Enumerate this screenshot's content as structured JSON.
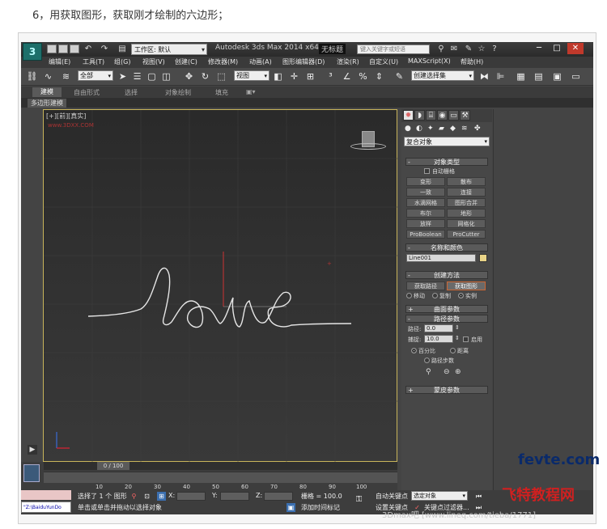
{
  "caption": "6，用获取图形，获取刚才绘制的六边形；",
  "titlebar": {
    "logo": "3",
    "workspace": "工作区: 默认",
    "app_title": "Autodesk 3ds Max  2014 x64",
    "file_name": "无标题",
    "search_placeholder": "键入关键字或短语",
    "help": "?"
  },
  "menu": [
    "编辑(E)",
    "工具(T)",
    "组(G)",
    "视图(V)",
    "创建(C)",
    "修改器(M)",
    "动画(A)",
    "图形编辑器(D)",
    "渲染(R)",
    "自定义(U)",
    "MAXScript(X)",
    "帮助(H)"
  ],
  "toolbar": {
    "selection_filter": "全部",
    "reference_coord": "视图",
    "named_selection": "创建选择集"
  },
  "ribbon": {
    "tabs": [
      "建模",
      "自由形式",
      "选择",
      "对象绘制",
      "填充"
    ],
    "active_tab": "建模",
    "sub_label": "多边形建模"
  },
  "viewport": {
    "label": "[+][前][真实]",
    "watermark": "www.3DXX.COM"
  },
  "command_panel": {
    "category": "复合对象",
    "object_type": {
      "title": "对象类型",
      "autogrid": "自动栅格",
      "buttons": [
        "变形",
        "散布",
        "一致",
        "连接",
        "水滴网格",
        "图形合并",
        "布尔",
        "地形",
        "放样",
        "网格化",
        "ProBoolean",
        "ProCutter"
      ]
    },
    "name_color": {
      "title": "名称和颜色",
      "name": "Line001",
      "color": "#e9d488"
    },
    "creation_method": {
      "title": "创建方法",
      "get_path": "获取路径",
      "get_shape": "获取图形",
      "options": [
        "移动",
        "复制",
        "实例"
      ],
      "selected": "实例"
    },
    "surface_params": "曲面参数",
    "path_params": {
      "title": "路径参数",
      "path_label": "路径:",
      "path_value": "0.0",
      "snap_label": "捕捉:",
      "snap_value": "10.0",
      "enable": "启用",
      "percent": "百分比",
      "distance": "距离",
      "path_steps": "路径步数"
    },
    "skin_params": "蒙皮参数"
  },
  "timeline": {
    "frame_label": "0 / 100",
    "ticks": [
      "10",
      "20",
      "30",
      "40",
      "50",
      "60",
      "70",
      "80",
      "90",
      "100"
    ]
  },
  "status": {
    "selected": "选择了 1 个 图形",
    "prompt": "单击或单击并拖动以选择对象",
    "x_label": "X:",
    "y_label": "Y:",
    "z_label": "Z:",
    "grid": "栅格 = 100.0",
    "add_time_tag": "添加时间标记",
    "auto_key": "自动关键点",
    "set_key": "设置关键点",
    "key_target": "选定对象",
    "key_filters": "关键点过滤器...",
    "maxscript_path": "\"Z:\\BaiduYunDo"
  },
  "watermarks": {
    "site1": "fevte.com",
    "site2": "飞特教程网",
    "site3": "3Dmax吧 [www.lineq.com/tieba/1771]"
  }
}
